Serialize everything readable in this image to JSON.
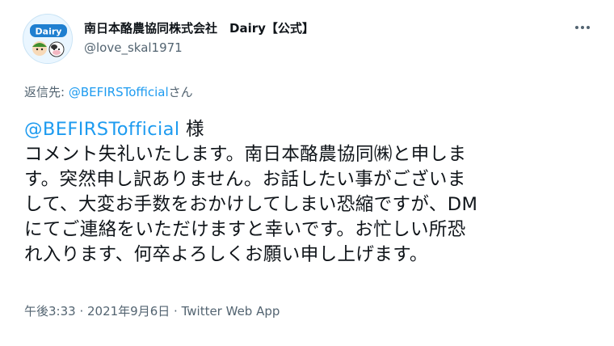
{
  "author": {
    "display_name": "南日本酪農協同株式会社　Dairy【公式】",
    "handle": "@love_skal1971",
    "avatar_text": "Dairy"
  },
  "reply_to": {
    "prefix": "返信先: ",
    "mention": "@BEFIRSTofficial",
    "suffix": "さん"
  },
  "tweet": {
    "mention": "@BEFIRSTofficial",
    "mention_suffix": " 様",
    "lines": [
      "コメント失礼いたします。南日本酪農協同㈱と申しま",
      "す。突然申し訳ありません。お話したい事がございま",
      "して、大変お手数をおかけしてしまい恐縮ですが、DM",
      "にてご連絡をいただけますと幸いです。お忙しい所恐",
      "れ入ります、何卒よろしくお願い申し上げます。"
    ]
  },
  "meta": {
    "time": "午後3:33",
    "separator": " · ",
    "date": "2021年9月6日",
    "app": "Twitter Web App"
  },
  "icons": {
    "more": "more-horizontal-icon"
  },
  "colors": {
    "link": "#1d9bf0",
    "secondary": "#536471",
    "text": "#0f1419"
  }
}
